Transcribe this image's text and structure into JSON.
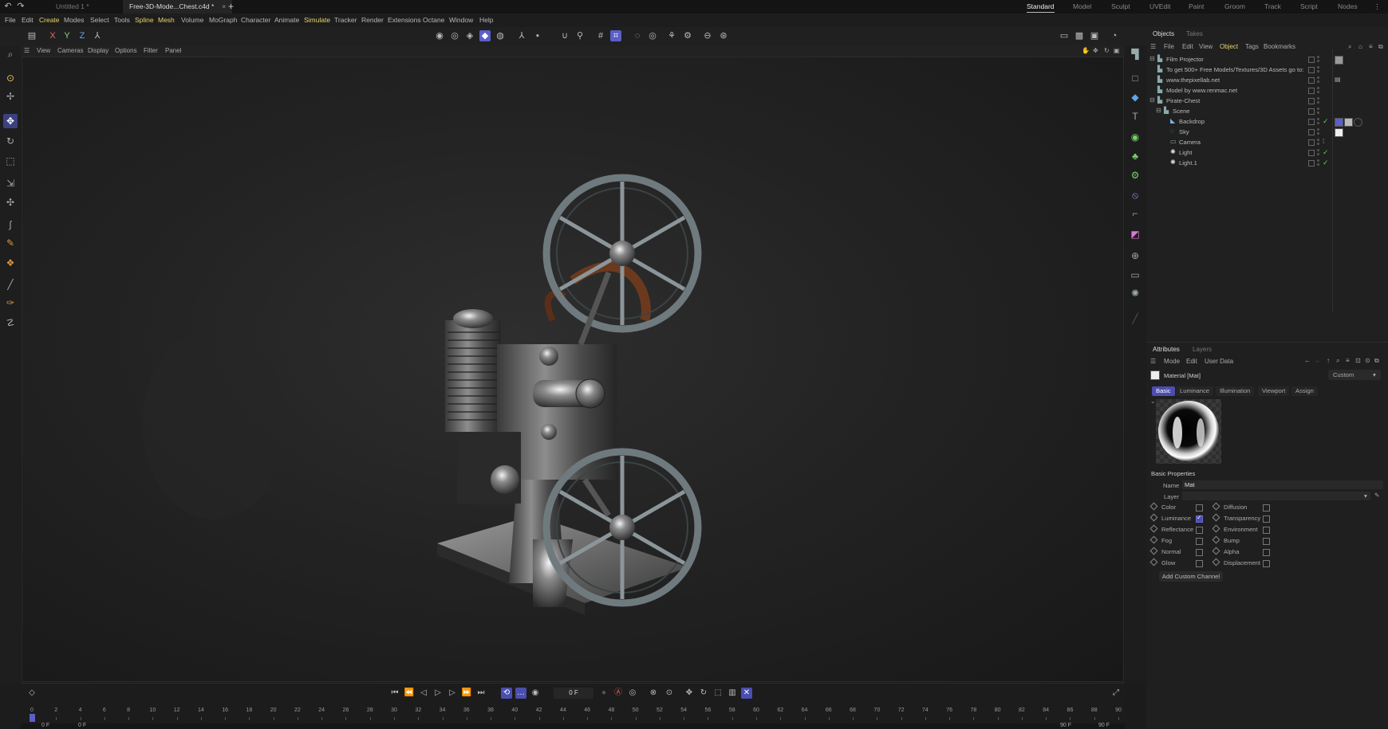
{
  "titlebar": {
    "tabs": [
      {
        "label": "Untitled 1 *",
        "active": false
      },
      {
        "label": "Free-3D-Mode...Chest.c4d *",
        "active": true
      }
    ],
    "close_glyph": "×",
    "add_tab_glyph": "+",
    "layouts": [
      "Standard",
      "Model",
      "Sculpt",
      "UVEdit",
      "Paint",
      "Groom",
      "Track",
      "Script",
      "Nodes"
    ],
    "active_layout": "Standard"
  },
  "menubar": {
    "items": [
      "File",
      "Edit",
      "Create",
      "Modes",
      "Select",
      "Tools",
      "Spline",
      "Mesh",
      "Volume",
      "MoGraph",
      "Character",
      "Animate",
      "Simulate",
      "Tracker",
      "Render",
      "Extensions",
      "Octane",
      "Window",
      "Help"
    ]
  },
  "axis_toggles": [
    "X",
    "Y",
    "Z"
  ],
  "viewport_menu": {
    "items": [
      "View",
      "Cameras",
      "Display",
      "Options",
      "Filter",
      "Panel"
    ]
  },
  "objects_panel": {
    "tabs": [
      "Objects",
      "Takes"
    ],
    "menu": [
      "File",
      "Edit",
      "View",
      "Object",
      "Tags",
      "Bookmarks"
    ],
    "items": [
      {
        "name": "Film Projector",
        "indent": 0,
        "expanded": true
      },
      {
        "name": "To get 500+ Free Models/Textures/3D Assets go to:",
        "indent": 0
      },
      {
        "name": "www.thepixellab.net",
        "indent": 0
      },
      {
        "name": "Model by www.renmac.net",
        "indent": 0
      },
      {
        "name": "Pirate-Chest",
        "indent": 0,
        "expanded": true
      },
      {
        "name": "Scene",
        "indent": 1,
        "expanded": true
      },
      {
        "name": "Backdrop",
        "indent": 2
      },
      {
        "name": "Sky",
        "indent": 2
      },
      {
        "name": "Camera",
        "indent": 2
      },
      {
        "name": "Light",
        "indent": 2
      },
      {
        "name": "Light.1",
        "indent": 2
      }
    ]
  },
  "attributes_panel": {
    "tabs": [
      "Attributes",
      "Layers"
    ],
    "menu": [
      "Mode",
      "Edit",
      "User Data"
    ],
    "material_title": "Material [Mat]",
    "mode_select": "Custom",
    "basic_tabs": [
      "Basic",
      "Luminance",
      "Illumination",
      "Viewport",
      "Assign"
    ],
    "section_title": "Basic Properties",
    "name_label": "Name",
    "name_value": "Mat",
    "layer_label": "Layer",
    "channels_left": [
      {
        "label": "Color",
        "checked": false
      },
      {
        "label": "Luminance",
        "checked": true
      },
      {
        "label": "Reflectance",
        "checked": false
      },
      {
        "label": "Fog",
        "checked": false
      },
      {
        "label": "Normal",
        "checked": false
      },
      {
        "label": "Glow",
        "checked": false
      }
    ],
    "channels_right": [
      {
        "label": "Diffusion",
        "checked": false
      },
      {
        "label": "Transparency",
        "checked": false
      },
      {
        "label": "Environment",
        "checked": false
      },
      {
        "label": "Bump",
        "checked": false
      },
      {
        "label": "Alpha",
        "checked": false
      },
      {
        "label": "Displacement",
        "checked": false
      }
    ],
    "add_channel_button": "Add Custom Channel"
  },
  "timeline": {
    "current_frame": "0 F",
    "start_left": "0 F",
    "start_right": "0 F",
    "end_left": "90 F",
    "end_right": "90 F",
    "ticks": [
      0,
      2,
      4,
      6,
      8,
      10,
      12,
      14,
      16,
      18,
      20,
      22,
      24,
      26,
      28,
      30,
      32,
      34,
      36,
      38,
      40,
      42,
      44,
      46,
      48,
      50,
      52,
      54,
      56,
      58,
      60,
      62,
      64,
      66,
      68,
      70,
      72,
      74,
      76,
      78,
      80,
      82,
      84,
      86,
      88,
      90
    ]
  },
  "colors": {
    "accent": "#5b5fc7",
    "highlight_menu": "#e8d46b",
    "check_green": "#5fcf5f"
  }
}
